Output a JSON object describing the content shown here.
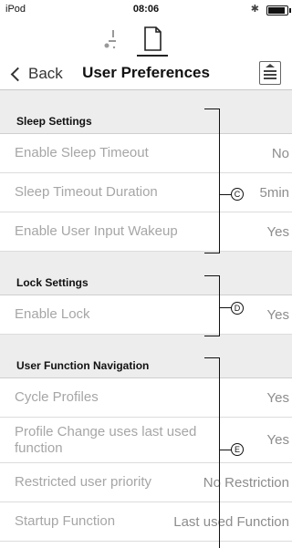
{
  "status_bar": {
    "carrier": "iPod",
    "time": "08:06",
    "bluetooth_symbol": "✱"
  },
  "nav": {
    "back_label": "Back",
    "title": "User Preferences"
  },
  "sections": [
    {
      "header": "Sleep Settings",
      "rows": [
        {
          "label": "Enable Sleep Timeout",
          "value": "No"
        },
        {
          "label": "Sleep Timeout Duration",
          "value": "5min"
        },
        {
          "label": "Enable User Input Wakeup",
          "value": "Yes"
        }
      ]
    },
    {
      "header": "Lock Settings",
      "rows": [
        {
          "label": "Enable Lock",
          "value": "Yes"
        }
      ]
    },
    {
      "header": "User Function Navigation",
      "rows": [
        {
          "label": "Cycle Profiles",
          "value": "Yes"
        },
        {
          "label": "Profile Change uses last used function",
          "value": "Yes"
        },
        {
          "label": "Restricted user priority",
          "value": "No Restriction"
        },
        {
          "label": "Startup Function",
          "value": "Last used Function"
        }
      ]
    }
  ],
  "callouts": {
    "c": "C",
    "d": "D",
    "e": "E"
  }
}
